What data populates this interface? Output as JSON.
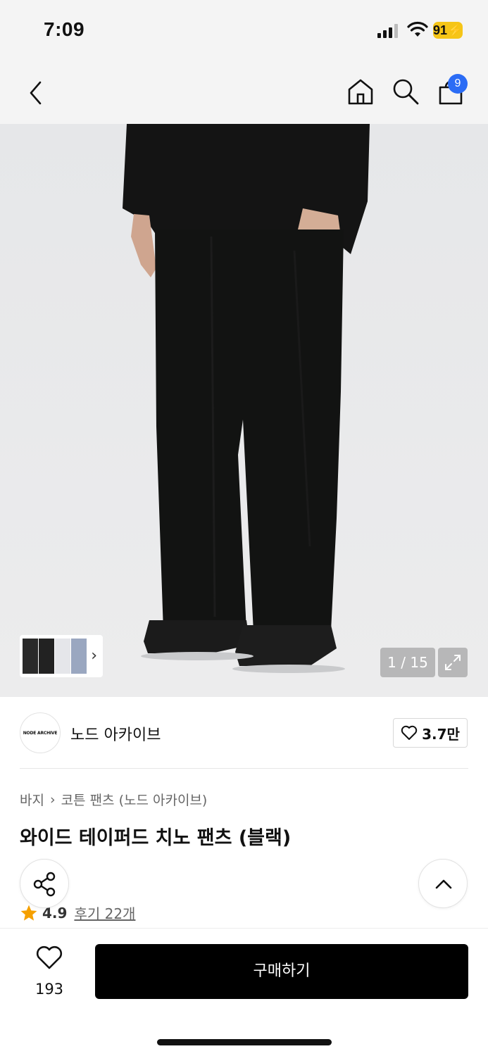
{
  "status_bar": {
    "time": "7:09",
    "battery": "91"
  },
  "nav": {
    "cart_count": "9"
  },
  "image": {
    "counter": "1 / 15"
  },
  "brand": {
    "logo_text": "NODE ARCHIVE",
    "name": "노드 아카이브",
    "likes": "3.7만"
  },
  "breadcrumb": {
    "category": "바지",
    "subcategory": "코튼 팬츠 (노드 아카이브)"
  },
  "product": {
    "title": "와이드 테이퍼드 치노 팬츠 (블랙)"
  },
  "rating": {
    "value": "4.9",
    "reviews": "후기 22개"
  },
  "bottom_bar": {
    "wish_count": "193",
    "buy_label": "구매하기"
  },
  "colors": {
    "badge": "#2b6cf5",
    "battery": "#f5c518",
    "star": "#f5a000",
    "buy_button": "#000000"
  }
}
